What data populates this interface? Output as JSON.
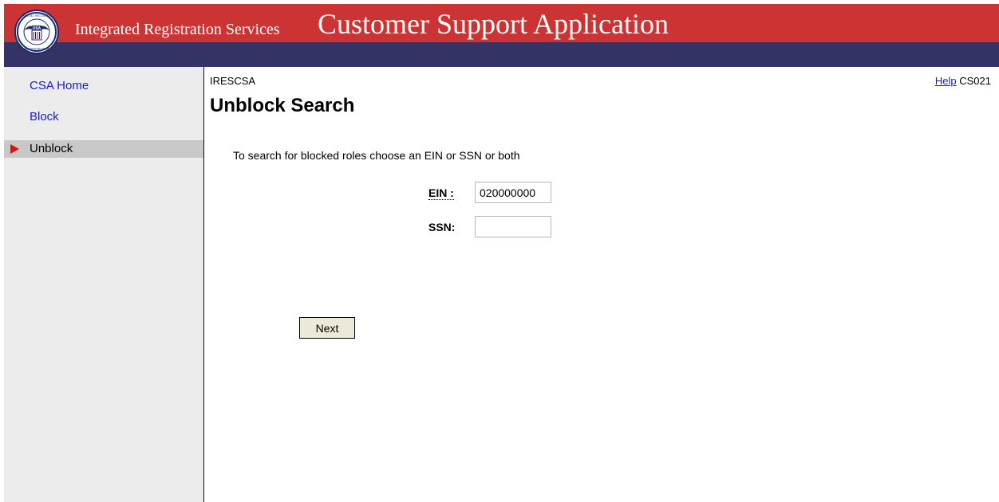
{
  "header": {
    "logo": "ssa-seal-icon",
    "logo_text": {
      "top_arc": "SOCIAL SECURITY",
      "center": "USA",
      "bottom_arc": "ADMINISTRATION"
    },
    "subtitle": "Integrated Registration Services",
    "title": "Customer Support Application"
  },
  "sidebar": {
    "items": [
      {
        "label": "CSA Home",
        "active": false
      },
      {
        "label": "Block",
        "active": false
      },
      {
        "label": "Unblock",
        "active": true
      }
    ]
  },
  "main": {
    "app_code": "IRESCSA",
    "page_title": "Unblock Search",
    "help_label": "Help",
    "screen_code": "CS021",
    "instructions": "To search for blocked roles choose an EIN or SSN or both",
    "fields": {
      "ein": {
        "label": "EIN :",
        "value": "020000000"
      },
      "ssn": {
        "label": "SSN:",
        "value": ""
      }
    },
    "next_label": "Next"
  },
  "colors": {
    "header_red": "#cc3333",
    "header_navy": "#333366",
    "sidebar_bg": "#ececec",
    "active_item_bg": "#c8c8c8",
    "link_blue": "#1a1acc",
    "marker_red": "#e01010"
  }
}
